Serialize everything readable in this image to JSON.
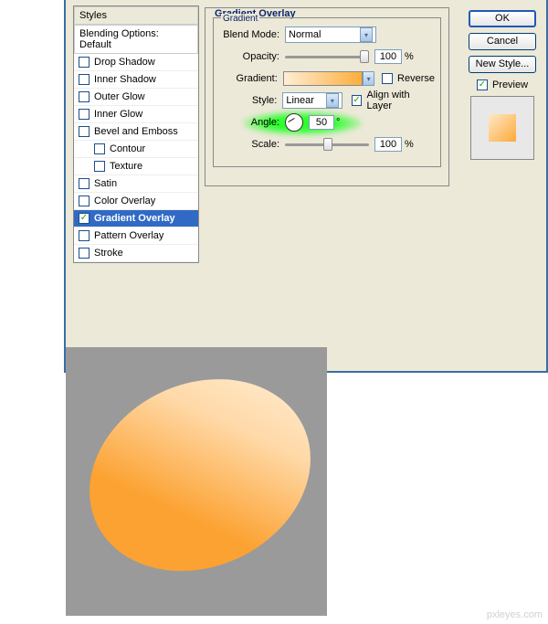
{
  "styles_panel": {
    "header": "Styles",
    "subheader": "Blending Options: Default",
    "items": [
      {
        "label": "Drop Shadow",
        "checked": false
      },
      {
        "label": "Inner Shadow",
        "checked": false
      },
      {
        "label": "Outer Glow",
        "checked": false
      },
      {
        "label": "Inner Glow",
        "checked": false
      },
      {
        "label": "Bevel and Emboss",
        "checked": false
      },
      {
        "label": "Contour",
        "checked": false,
        "sub": true
      },
      {
        "label": "Texture",
        "checked": false,
        "sub": true
      },
      {
        "label": "Satin",
        "checked": false
      },
      {
        "label": "Color Overlay",
        "checked": false
      },
      {
        "label": "Gradient Overlay",
        "checked": true,
        "selected": true
      },
      {
        "label": "Pattern Overlay",
        "checked": false
      },
      {
        "label": "Stroke",
        "checked": false
      }
    ]
  },
  "gradient_overlay": {
    "title": "Gradient Overlay",
    "section": "Gradient",
    "blend_mode_label": "Blend Mode:",
    "blend_mode_value": "Normal",
    "opacity_label": "Opacity:",
    "opacity_value": "100",
    "opacity_unit": "%",
    "gradient_label": "Gradient:",
    "reverse_label": "Reverse",
    "reverse_checked": false,
    "style_label": "Style:",
    "style_value": "Linear",
    "align_label": "Align with Layer",
    "align_checked": true,
    "angle_label": "Angle:",
    "angle_value": "50",
    "angle_unit": "°",
    "scale_label": "Scale:",
    "scale_value": "100",
    "scale_unit": "%"
  },
  "buttons": {
    "ok": "OK",
    "cancel": "Cancel",
    "new_style": "New Style...",
    "preview": "Preview",
    "preview_checked": true
  },
  "watermark": "pxleyes.com"
}
